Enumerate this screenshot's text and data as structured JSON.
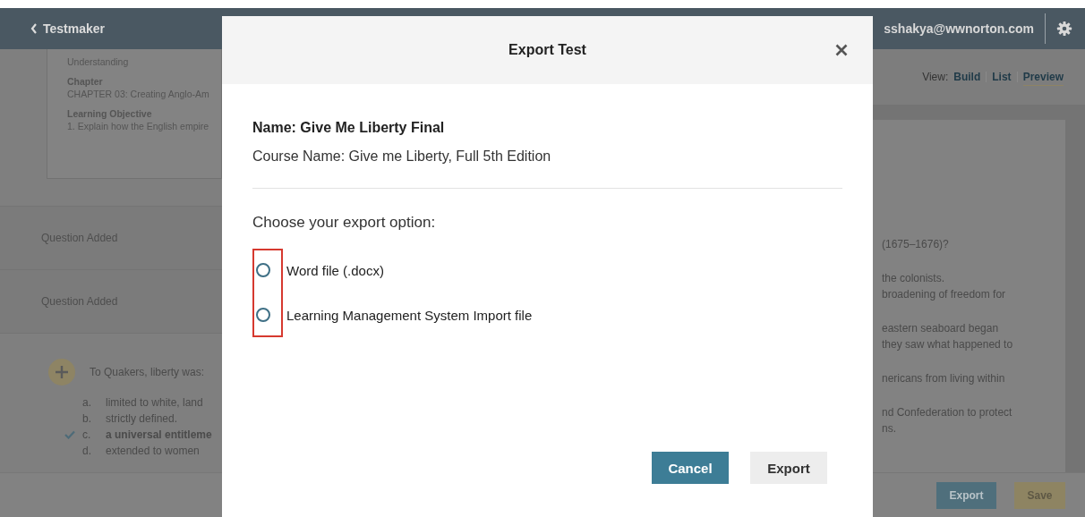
{
  "header": {
    "back_label": "Testmaker",
    "user_email": "sshakya@wwnorton.com"
  },
  "metadata": [
    {
      "value": "Understanding"
    },
    {
      "label": "Chapter",
      "value": "CHAPTER 03: Creating Anglo-Am"
    },
    {
      "label": "Learning Objective",
      "value": "1. Explain how the English empire"
    }
  ],
  "question_rows": [
    "Question Added",
    "Question Added"
  ],
  "question": {
    "text": "To Quakers, liberty was:",
    "options": [
      {
        "letter": "a.",
        "text": "limited to white, land",
        "correct": false
      },
      {
        "letter": "b.",
        "text": "strictly defined.",
        "correct": false
      },
      {
        "letter": "c.",
        "text": "a universal entitleme",
        "correct": true
      },
      {
        "letter": "d.",
        "text": "extended to women",
        "correct": false
      }
    ]
  },
  "view_switch": {
    "label": "View:",
    "options": [
      {
        "label": "Build",
        "selected": false
      },
      {
        "label": "List",
        "selected": false
      },
      {
        "label": "Preview",
        "selected": true
      }
    ]
  },
  "preview_blocks": [
    [
      "(1675–1676)?"
    ],
    [
      "the colonists.",
      "broadening of freedom for"
    ],
    [
      "eastern seaboard began",
      "they saw what happened to"
    ],
    [
      "nericans from living within"
    ],
    [
      "nd Confederation to protect",
      "ns."
    ]
  ],
  "footer_buttons": [
    {
      "label": "Export",
      "kind": "primary"
    },
    {
      "label": "Save",
      "kind": "accent"
    }
  ],
  "modal": {
    "title": "Export Test",
    "name": "Name: Give Me Liberty Final",
    "course": "Course Name: Give me Liberty, Full 5th Edition",
    "prompt": "Choose your export option:",
    "options": [
      {
        "label": "Word file (.docx)",
        "selected": false
      },
      {
        "label": "Learning Management System Import file",
        "selected": false
      }
    ],
    "highlighted": true,
    "buttons": [
      {
        "label": "Cancel",
        "kind": "primary"
      },
      {
        "label": "Export",
        "kind": "secondary"
      }
    ]
  }
}
